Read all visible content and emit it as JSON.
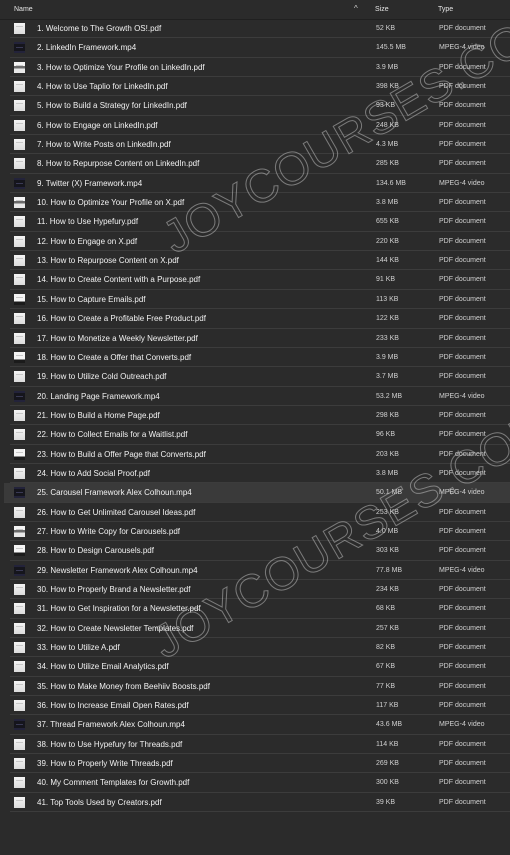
{
  "header": {
    "name_label": "Name",
    "size_label": "Size",
    "type_label": "Type",
    "sort_indicator": "^"
  },
  "files": [
    {
      "name": "1. Welcome to The Growth OS!.pdf",
      "size": "52 KB",
      "type": "PDF document",
      "icon": "pdf"
    },
    {
      "name": "2. LinkedIn Framework.mp4",
      "size": "145.5 MB",
      "type": "MPEG-4 video",
      "icon": "video"
    },
    {
      "name": "3. How to Optimize Your Profile on LinkedIn.pdf",
      "size": "3.9 MB",
      "type": "PDF document",
      "icon": "pdf-banner"
    },
    {
      "name": "4. How to Use Taplio for LinkedIn.pdf",
      "size": "398 KB",
      "type": "PDF document",
      "icon": "pdf"
    },
    {
      "name": "5. How to Build a Strategy for LinkedIn.pdf",
      "size": "93 KB",
      "type": "PDF document",
      "icon": "pdf"
    },
    {
      "name": "6. How to Engage on LinkedIn.pdf",
      "size": "248 KB",
      "type": "PDF document",
      "icon": "pdf"
    },
    {
      "name": "7. How to Write Posts on LinkedIn.pdf",
      "size": "4.3 MB",
      "type": "PDF document",
      "icon": "pdf"
    },
    {
      "name": "8. How to Repurpose Content on LinkedIn.pdf",
      "size": "285 KB",
      "type": "PDF document",
      "icon": "pdf"
    },
    {
      "name": "9. Twitter (X) Framework.mp4",
      "size": "134.6 MB",
      "type": "MPEG-4 video",
      "icon": "video"
    },
    {
      "name": "10. How to Optimize Your Profile on X.pdf",
      "size": "3.8 MB",
      "type": "PDF document",
      "icon": "pdf-banner"
    },
    {
      "name": "11. How to Use Hypefury.pdf",
      "size": "655 KB",
      "type": "PDF document",
      "icon": "pdf"
    },
    {
      "name": "12. How to Engage on X.pdf",
      "size": "220 KB",
      "type": "PDF document",
      "icon": "pdf"
    },
    {
      "name": "13. How to Repurpose Content on X.pdf",
      "size": "144 KB",
      "type": "PDF document",
      "icon": "pdf"
    },
    {
      "name": "14. How to Create Content with a Purpose.pdf",
      "size": "91 KB",
      "type": "PDF document",
      "icon": "pdf"
    },
    {
      "name": "15. How to Capture Emails.pdf",
      "size": "113 KB",
      "type": "PDF document",
      "icon": "pdf-foot"
    },
    {
      "name": "16. How to Create a Profitable Free Product.pdf",
      "size": "122 KB",
      "type": "PDF document",
      "icon": "pdf"
    },
    {
      "name": "17. How to Monetize a Weekly Newsletter.pdf",
      "size": "233 KB",
      "type": "PDF document",
      "icon": "pdf"
    },
    {
      "name": "18. How to Create a Offer that Converts.pdf",
      "size": "3.9 MB",
      "type": "PDF document",
      "icon": "pdf-foot"
    },
    {
      "name": "19. How to Utilize Cold Outreach.pdf",
      "size": "3.7 MB",
      "type": "PDF document",
      "icon": "pdf"
    },
    {
      "name": "20. Landing Page Framework.mp4",
      "size": "53.2 MB",
      "type": "MPEG-4 video",
      "icon": "video"
    },
    {
      "name": "21. How to Build a Home Page.pdf",
      "size": "298 KB",
      "type": "PDF document",
      "icon": "pdf"
    },
    {
      "name": "22. How to Collect Emails for a Waitlist.pdf",
      "size": "96 KB",
      "type": "PDF document",
      "icon": "pdf"
    },
    {
      "name": "23. How to Build a Offer Page that Converts.pdf",
      "size": "203 KB",
      "type": "PDF document",
      "icon": "pdf-foot"
    },
    {
      "name": "24. How to Add Social Proof.pdf",
      "size": "3.8 MB",
      "type": "PDF document",
      "icon": "pdf"
    },
    {
      "name": "25. Carousel Framework Alex Colhoun.mp4",
      "size": "50.1 MB",
      "type": "MPEG-4 video",
      "icon": "video",
      "hover": true
    },
    {
      "name": "26. How to Get Unlimited Carousel Ideas.pdf",
      "size": "253 KB",
      "type": "PDF document",
      "icon": "pdf"
    },
    {
      "name": "27. How to Write Copy for Carousels.pdf",
      "size": "4.0 MB",
      "type": "PDF document",
      "icon": "pdf-banner"
    },
    {
      "name": "28. How to Design Carousels.pdf",
      "size": "303 KB",
      "type": "PDF document",
      "icon": "pdf-foot"
    },
    {
      "name": "29. Newsletter Framework Alex Colhoun.mp4",
      "size": "77.8 MB",
      "type": "MPEG-4 video",
      "icon": "video"
    },
    {
      "name": "30. How to Properly Brand a Newsletter.pdf",
      "size": "234 KB",
      "type": "PDF document",
      "icon": "pdf"
    },
    {
      "name": "31. How to Get Inspiration for a Newsletter.pdf",
      "size": "68 KB",
      "type": "PDF document",
      "icon": "pdf"
    },
    {
      "name": "32. How to Create Newsletter Templates.pdf",
      "size": "257 KB",
      "type": "PDF document",
      "icon": "pdf"
    },
    {
      "name": "33. How to Utilize A.pdf",
      "size": "82 KB",
      "type": "PDF document",
      "icon": "pdf"
    },
    {
      "name": "34. How to Utilize Email Analytics.pdf",
      "size": "67 KB",
      "type": "PDF document",
      "icon": "pdf"
    },
    {
      "name": "35. How to Make Money from Beehiiv Boosts.pdf",
      "size": "77 KB",
      "type": "PDF document",
      "icon": "pdf"
    },
    {
      "name": "36. How to Increase Email Open Rates.pdf",
      "size": "117 KB",
      "type": "PDF document",
      "icon": "pdf"
    },
    {
      "name": "37. Thread Framework Alex Colhoun.mp4",
      "size": "43.6 MB",
      "type": "MPEG-4 video",
      "icon": "video"
    },
    {
      "name": "38. How to Use Hypefury for Threads.pdf",
      "size": "114 KB",
      "type": "PDF document",
      "icon": "pdf"
    },
    {
      "name": "39. How to Properly Write Threads.pdf",
      "size": "269 KB",
      "type": "PDF document",
      "icon": "pdf"
    },
    {
      "name": "40. My Comment Templates for Growth.pdf",
      "size": "300 KB",
      "type": "PDF document",
      "icon": "pdf"
    },
    {
      "name": "41. Top Tools Used by Creators.pdf",
      "size": "39 KB",
      "type": "PDF document",
      "icon": "pdf"
    }
  ],
  "watermark": {
    "text": "JOYCOURSES.COM"
  }
}
